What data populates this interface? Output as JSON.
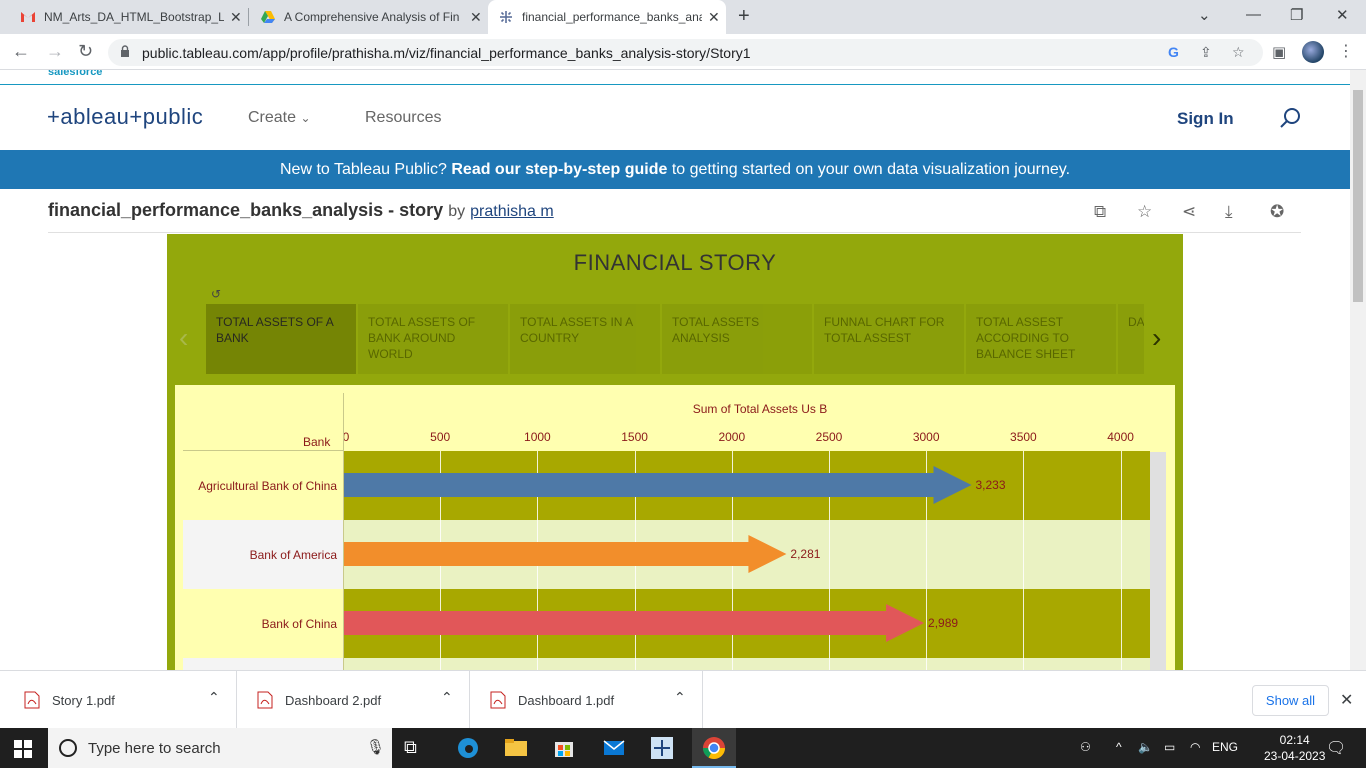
{
  "browser": {
    "tabs": [
      {
        "title": "NM_Arts_DA_HTML_Bootstrap_Li",
        "icon": "gmail-icon"
      },
      {
        "title": "A Comprehensive Analysis of Fin",
        "icon": "google-drive-icon"
      },
      {
        "title": "financial_performance_banks_ana",
        "icon": "tableau-icon"
      }
    ],
    "url": "public.tableau.com/app/profile/prathisha.m/viz/financial_performance_banks_analysis-story/Story1"
  },
  "site": {
    "brand_partial": "salesforce",
    "logo": "+ableau+public",
    "nav": {
      "create": "Create",
      "resources": "Resources"
    },
    "sign_in": "Sign In",
    "banner": {
      "prefix": "New to Tableau Public?",
      "link": "Read our step-by-step guide",
      "suffix": "to getting started on your own data visualization journey."
    }
  },
  "viz": {
    "title": "financial_performance_banks_analysis - story",
    "by": "by",
    "author": "prathisha m"
  },
  "story": {
    "title": "FINANCIAL STORY",
    "points": [
      {
        "label": "TOTAL ASSETS OF A BANK"
      },
      {
        "label": "TOTAL ASSETS OF BANK AROUND WORLD"
      },
      {
        "label": "TOTAL ASSETS IN A COUNTRY"
      },
      {
        "label": "TOTAL ASSETS ANALYSIS"
      },
      {
        "label": "FUNNAL CHART FOR TOTAL ASSEST"
      },
      {
        "label": "TOTAL ASSEST ACCORDING TO BALANCE SHEET"
      },
      {
        "label": "DA"
      }
    ]
  },
  "chart_data": {
    "type": "bar",
    "title": "",
    "xlabel": "Sum of Total Assets Us B",
    "ylabel": "Bank",
    "xlim": [
      0,
      4200
    ],
    "ticks": [
      0,
      500,
      1000,
      1500,
      2000,
      2500,
      3000,
      3500,
      4000
    ],
    "tick_labels": [
      "0",
      "500",
      "1000",
      "1500",
      "2000",
      "2500",
      "3000",
      "3500",
      "4000"
    ],
    "categories": [
      "Agricultural Bank of China",
      "Bank of America",
      "Bank of China"
    ],
    "values": [
      3233,
      2281,
      2989
    ],
    "value_labels": [
      "3,233",
      "2,281",
      "2,989"
    ],
    "colors": [
      "#4e79a7",
      "#f28e2b",
      "#e15759"
    ],
    "row_colors": [
      "#a8a800",
      "#eaf2c2",
      "#a8a800"
    ],
    "label_row_colors": [
      "#ffffb0",
      "#f4f4f4",
      "#ffffb0"
    ]
  },
  "downloads": {
    "items": [
      "Story 1.pdf",
      "Dashboard 2.pdf",
      "Dashboard 1.pdf"
    ],
    "show_all": "Show all"
  },
  "taskbar": {
    "search_placeholder": "Type here to search",
    "lang": "ENG",
    "time": "02:14",
    "date": "23-04-2023"
  }
}
